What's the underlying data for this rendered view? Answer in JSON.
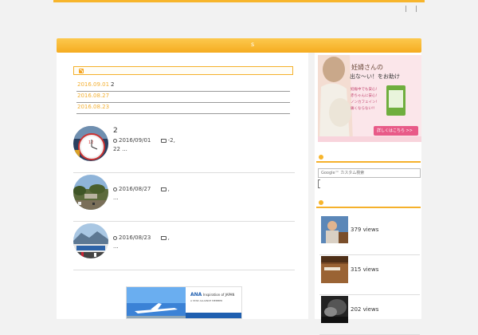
{
  "header": {
    "links": [
      "|",
      "|"
    ]
  },
  "nav": {
    "item": "s"
  },
  "new_list": [
    {
      "date": "2016.09.01",
      "title": "2"
    },
    {
      "date": "2016.08.27",
      "title": ""
    },
    {
      "date": "2016.08.23",
      "title": ""
    }
  ],
  "posts": [
    {
      "title": "2",
      "date": "2016/09/01",
      "category": "-2,",
      "excerpt": "22 ..."
    },
    {
      "title": "",
      "date": "2016/08/27",
      "category": ",",
      "excerpt": "..."
    },
    {
      "title": "",
      "date": "2016/08/23",
      "category": ",",
      "excerpt": "..."
    }
  ],
  "ad_bottom": {
    "brand": "ANA",
    "tagline": "Inspiration of JAPAN",
    "alliance": "A STAR ALLIANCE MEMBER"
  },
  "sidebar_ad": {
    "headline_1": "妊婦さんの",
    "headline_2": "出な〜い！をお助け",
    "bullets": [
      "妊娠中でも安心!",
      "赤ちゃんに安心!",
      "ノンカフェイン!",
      "痛くならない!!"
    ],
    "cta": "詳しくはこちら >>"
  },
  "search": {
    "placeholder": "Google™ カスタム検索"
  },
  "popular": [
    {
      "views": "379 views"
    },
    {
      "views": "315 views"
    },
    {
      "views": "202 views"
    }
  ],
  "colors": {
    "accent": "#f5b12b",
    "date": "#f3b033"
  }
}
